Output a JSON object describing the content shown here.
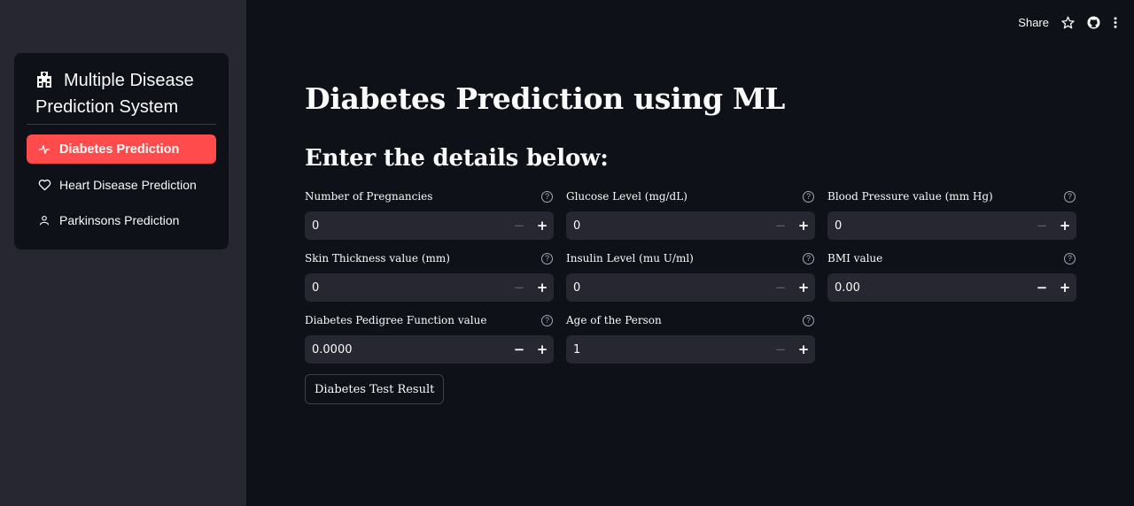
{
  "toolbar": {
    "share_label": "Share"
  },
  "sidebar": {
    "title": "Multiple Disease Prediction System",
    "items": [
      {
        "label": "Diabetes Prediction",
        "icon": "activity-icon"
      },
      {
        "label": "Heart Disease Prediction",
        "icon": "heart-icon"
      },
      {
        "label": "Parkinsons Prediction",
        "icon": "person-icon"
      }
    ]
  },
  "main": {
    "title": "Diabetes Prediction using ML",
    "subtitle": "Enter the details below:",
    "fields": [
      {
        "label": "Number of Pregnancies",
        "value": "0",
        "minus_enabled": false
      },
      {
        "label": "Glucose Level (mg/dL)",
        "value": "0",
        "minus_enabled": false
      },
      {
        "label": "Blood Pressure value (mm Hg)",
        "value": "0",
        "minus_enabled": false
      },
      {
        "label": "Skin Thickness value (mm)",
        "value": "0",
        "minus_enabled": false
      },
      {
        "label": "Insulin Level (mu U/ml)",
        "value": "0",
        "minus_enabled": false
      },
      {
        "label": "BMI value",
        "value": "0.00",
        "minus_enabled": true
      },
      {
        "label": "Diabetes Pedigree Function value",
        "value": "0.0000",
        "minus_enabled": true
      },
      {
        "label": "Age of the Person",
        "value": "1",
        "minus_enabled": false
      }
    ],
    "submit_label": "Diabetes Test Result"
  },
  "colors": {
    "accent": "#ff4b4b",
    "background": "#0e1117",
    "sidebar": "#262730"
  }
}
